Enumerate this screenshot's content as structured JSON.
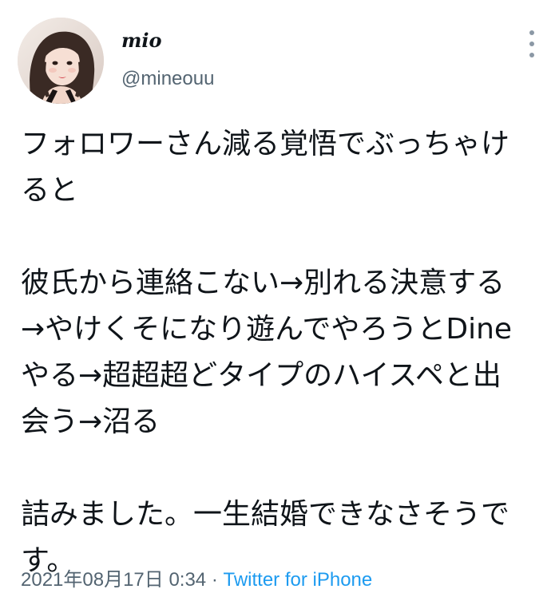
{
  "author": {
    "display_name": "mio",
    "handle": "@mineouu"
  },
  "tweet": {
    "lines": [
      "フォロワーさん減る覚悟でぶっちゃけ",
      "ると",
      "",
      "彼氏から連絡こない→別れる決意する",
      "→やけくそになり遊んでやろうとDine",
      "やる→超超超どタイプのハイスペと出",
      "会う→沼る",
      "",
      "詰みました。一生結婚できなさそうで",
      "す。"
    ]
  },
  "meta": {
    "timestamp": "2021年08月17日 0:34",
    "separator": " · ",
    "source": "Twitter for iPhone"
  },
  "colors": {
    "text": "#0f1419",
    "secondary": "#536471",
    "link": "#1d9bf0"
  },
  "icons": {
    "more": "vertical-ellipsis-icon",
    "avatar": "profile-photo"
  }
}
